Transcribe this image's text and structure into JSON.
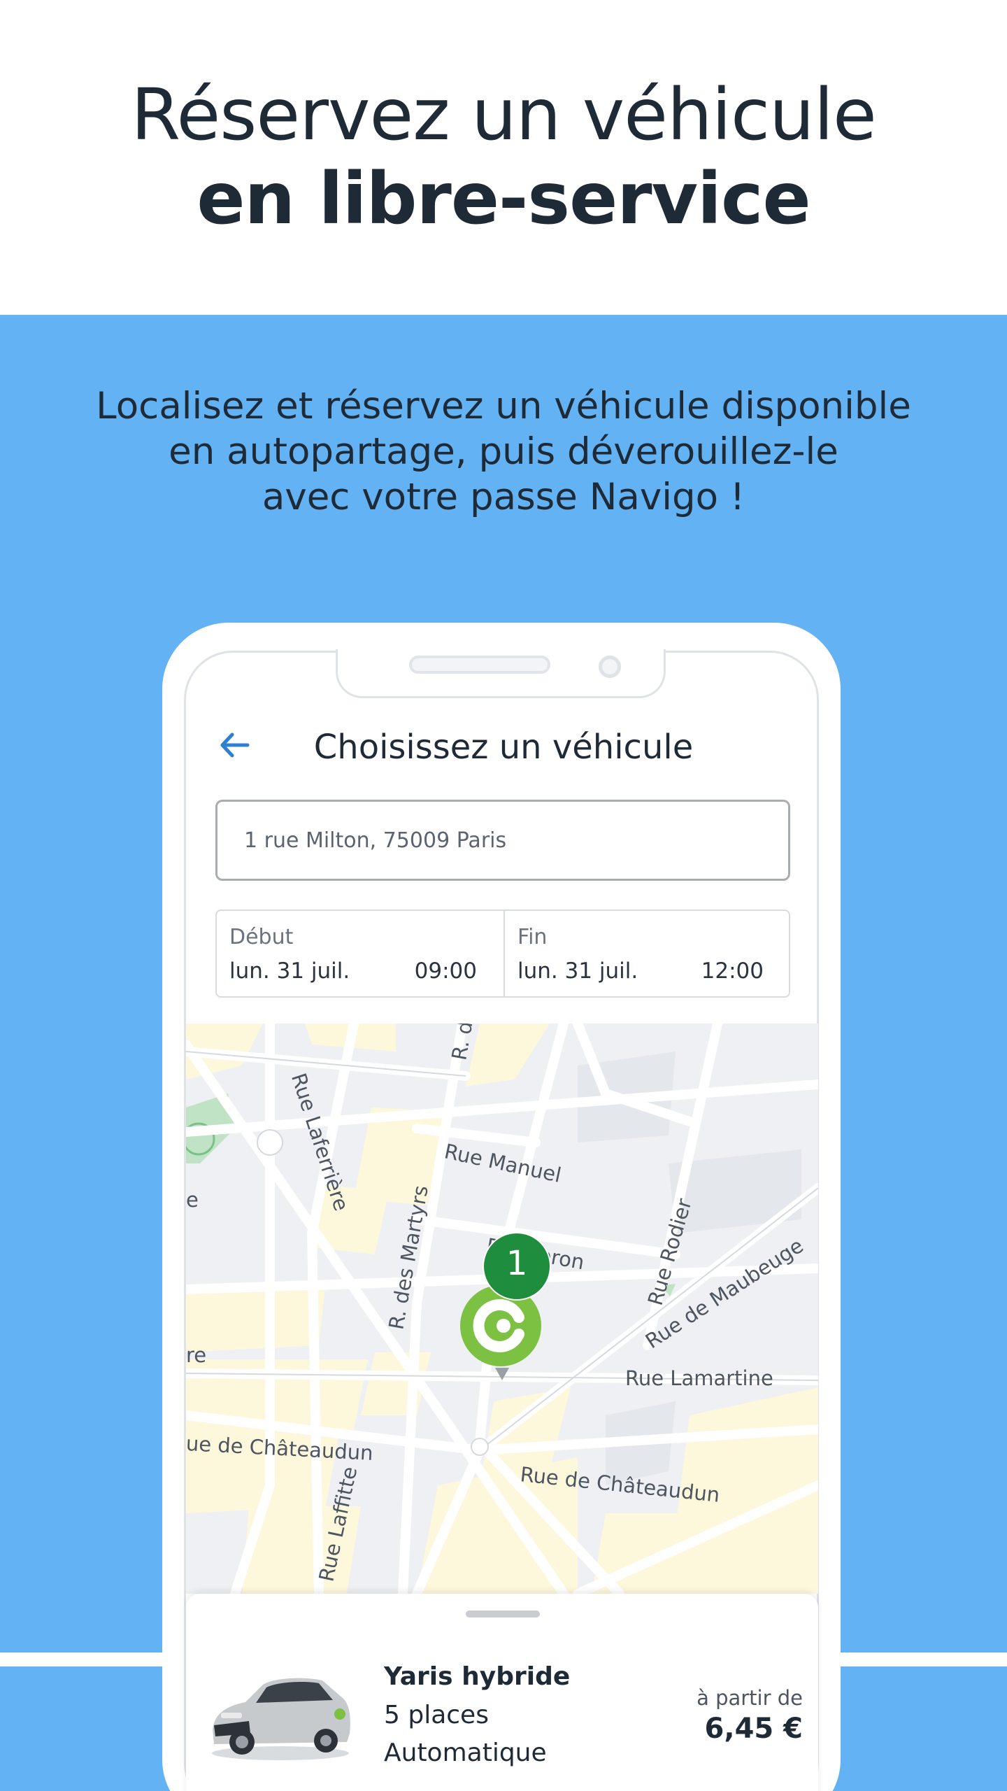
{
  "header": {
    "line1": "Réservez un véhicule",
    "line2": "en libre-service"
  },
  "subtitle": {
    "line1": "Localisez et réservez un véhicule disponible",
    "line2": "en autopartage, puis déverouillez-le",
    "line3": "avec votre passe Navigo !"
  },
  "screen": {
    "title": "Choisissez un véhicule",
    "address": "1 rue Milton, 75009 Paris",
    "start": {
      "label": "Début",
      "date": "lun. 31 juil.",
      "time": "09:00"
    },
    "end": {
      "label": "Fin",
      "date": "lun. 31 juil.",
      "time": "12:00"
    }
  },
  "map": {
    "streets": [
      "Rue Laferrière",
      "Rue Manuel",
      "R. des Martyrs",
      "R. Choron",
      "Rue Rodier",
      "Rue de Maubeuge",
      "Rue Lamartine",
      "ue de Châteaudun",
      "Rue de Châteaudun",
      "Rue Laffitte",
      "R. d",
      "re",
      "e"
    ],
    "marker_count": "1"
  },
  "vehicle": {
    "name": "Yaris hybride",
    "seats": "5 places",
    "transmission": "Automatique",
    "price_prefix": "à partir de",
    "price": "6,45 €"
  },
  "colors": {
    "accent_blue": "#63b2f4",
    "text_dark": "#1f2a37",
    "marker_green": "#1e8e3e",
    "brand_green": "#7cc142"
  }
}
